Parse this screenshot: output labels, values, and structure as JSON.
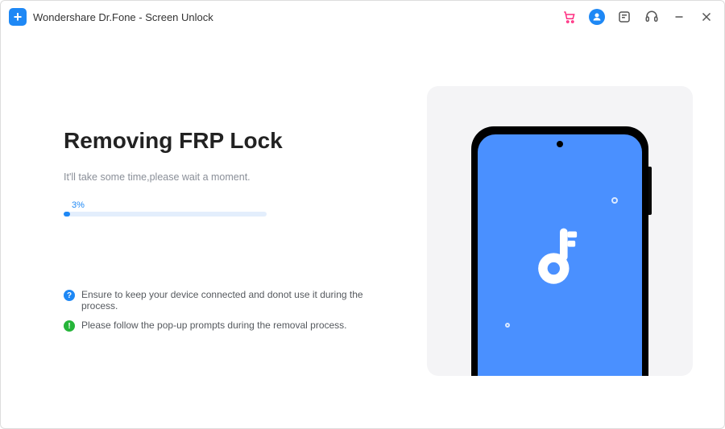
{
  "header": {
    "app_title": "Wondershare Dr.Fone - Screen Unlock"
  },
  "main": {
    "title": "Removing FRP Lock",
    "subtitle": "It'll take some time,please wait a moment.",
    "progress_text": "3%",
    "progress_value": 3,
    "tips": [
      {
        "icon": "?",
        "color": "blue",
        "text": "Ensure to keep your device connected and  donot use it  during the process."
      },
      {
        "icon": "!",
        "color": "green",
        "text": "Please follow the pop-up prompts during the removal process."
      }
    ]
  },
  "colors": {
    "accent": "#1e88f5",
    "cart": "#ff2a7f",
    "success": "#26b53a"
  }
}
